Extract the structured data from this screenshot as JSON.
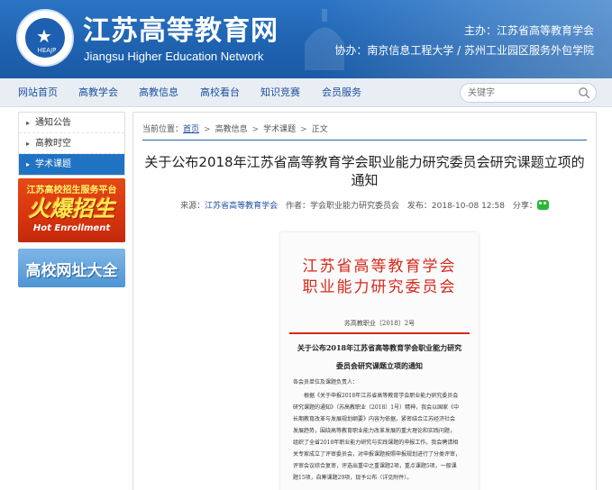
{
  "header": {
    "logo_text": "HEAJP",
    "site_title": "江苏高等教育网",
    "site_subtitle": "Jiangsu Higher Education Network",
    "host": "主办：江苏省高等教育学会",
    "co_host": "协办：南京信息工程大学 / 苏州工业园区服务外包学院"
  },
  "nav": {
    "items": [
      "网站首页",
      "高教学会",
      "高教信息",
      "高校看台",
      "知识竞赛",
      "会员服务"
    ],
    "search_placeholder": "关键字"
  },
  "sidebar": {
    "items": [
      {
        "label": "通知公告",
        "active": false
      },
      {
        "label": "高教时空",
        "active": false
      },
      {
        "label": "学术课题",
        "active": true
      }
    ],
    "promo1": {
      "top": "江苏高校招生服务平台",
      "big": "火爆招生",
      "en": "Hot Enrollment"
    },
    "promo2": {
      "text": "高校网址大全"
    }
  },
  "breadcrumb": {
    "prefix": "当前位置：",
    "home": "首页",
    "level1": "高教信息",
    "level2": "学术课题",
    "level3": "正文"
  },
  "article": {
    "title": "关于公布2018年江苏省高等教育学会职业能力研究委员会研究课题立项的通知",
    "source_label": "来源：",
    "source": "江苏省高等教育学会",
    "author_label": "作者：",
    "author": "学会职业能力研究委员会",
    "date_label": "发布：",
    "date": "2018-10-08 12:58",
    "share_label": "分享："
  },
  "document": {
    "head1": "江苏省高等教育学会",
    "head2": "职业能力研究委员会",
    "doc_number": "苏高教职业〔2018〕2号",
    "title1": "关于公布2018年江苏省高等教育学会职业能力研究",
    "title2": "委员会研究课题立项的通知",
    "salutation": "各会员单位及课题负责人：",
    "body_lines": [
      "　　根据《关于申报2018年江苏省高等教育学会职业能力研究委员会",
      "研究课题的通知》（苏高教职业〔2018〕1号）精神，我会以国家《中",
      "长期教育改革与发展规划纲要》内容为依据，紧密结合江苏经济社会",
      "发展趋势，围绕高等教育职业能力改革发展的重大理论和实践问题，",
      "组织了全省2018年职业能力研究与实践课题的申报工作。我会聘请相",
      "关专家成立了评审委员会，对申报课题按照申报规划进行了分类评审，",
      "评审会议综合复审，评选出重中之重课题2项，重点课题5项，一般课",
      "题15项，自筹课题29项，现予公布（详见附件）。"
    ]
  },
  "colors": {
    "header_blue": "#1f63b1",
    "link_blue": "#1c4f9c",
    "active_blue": "#1f73c2",
    "doc_red": "#d42a1e"
  }
}
